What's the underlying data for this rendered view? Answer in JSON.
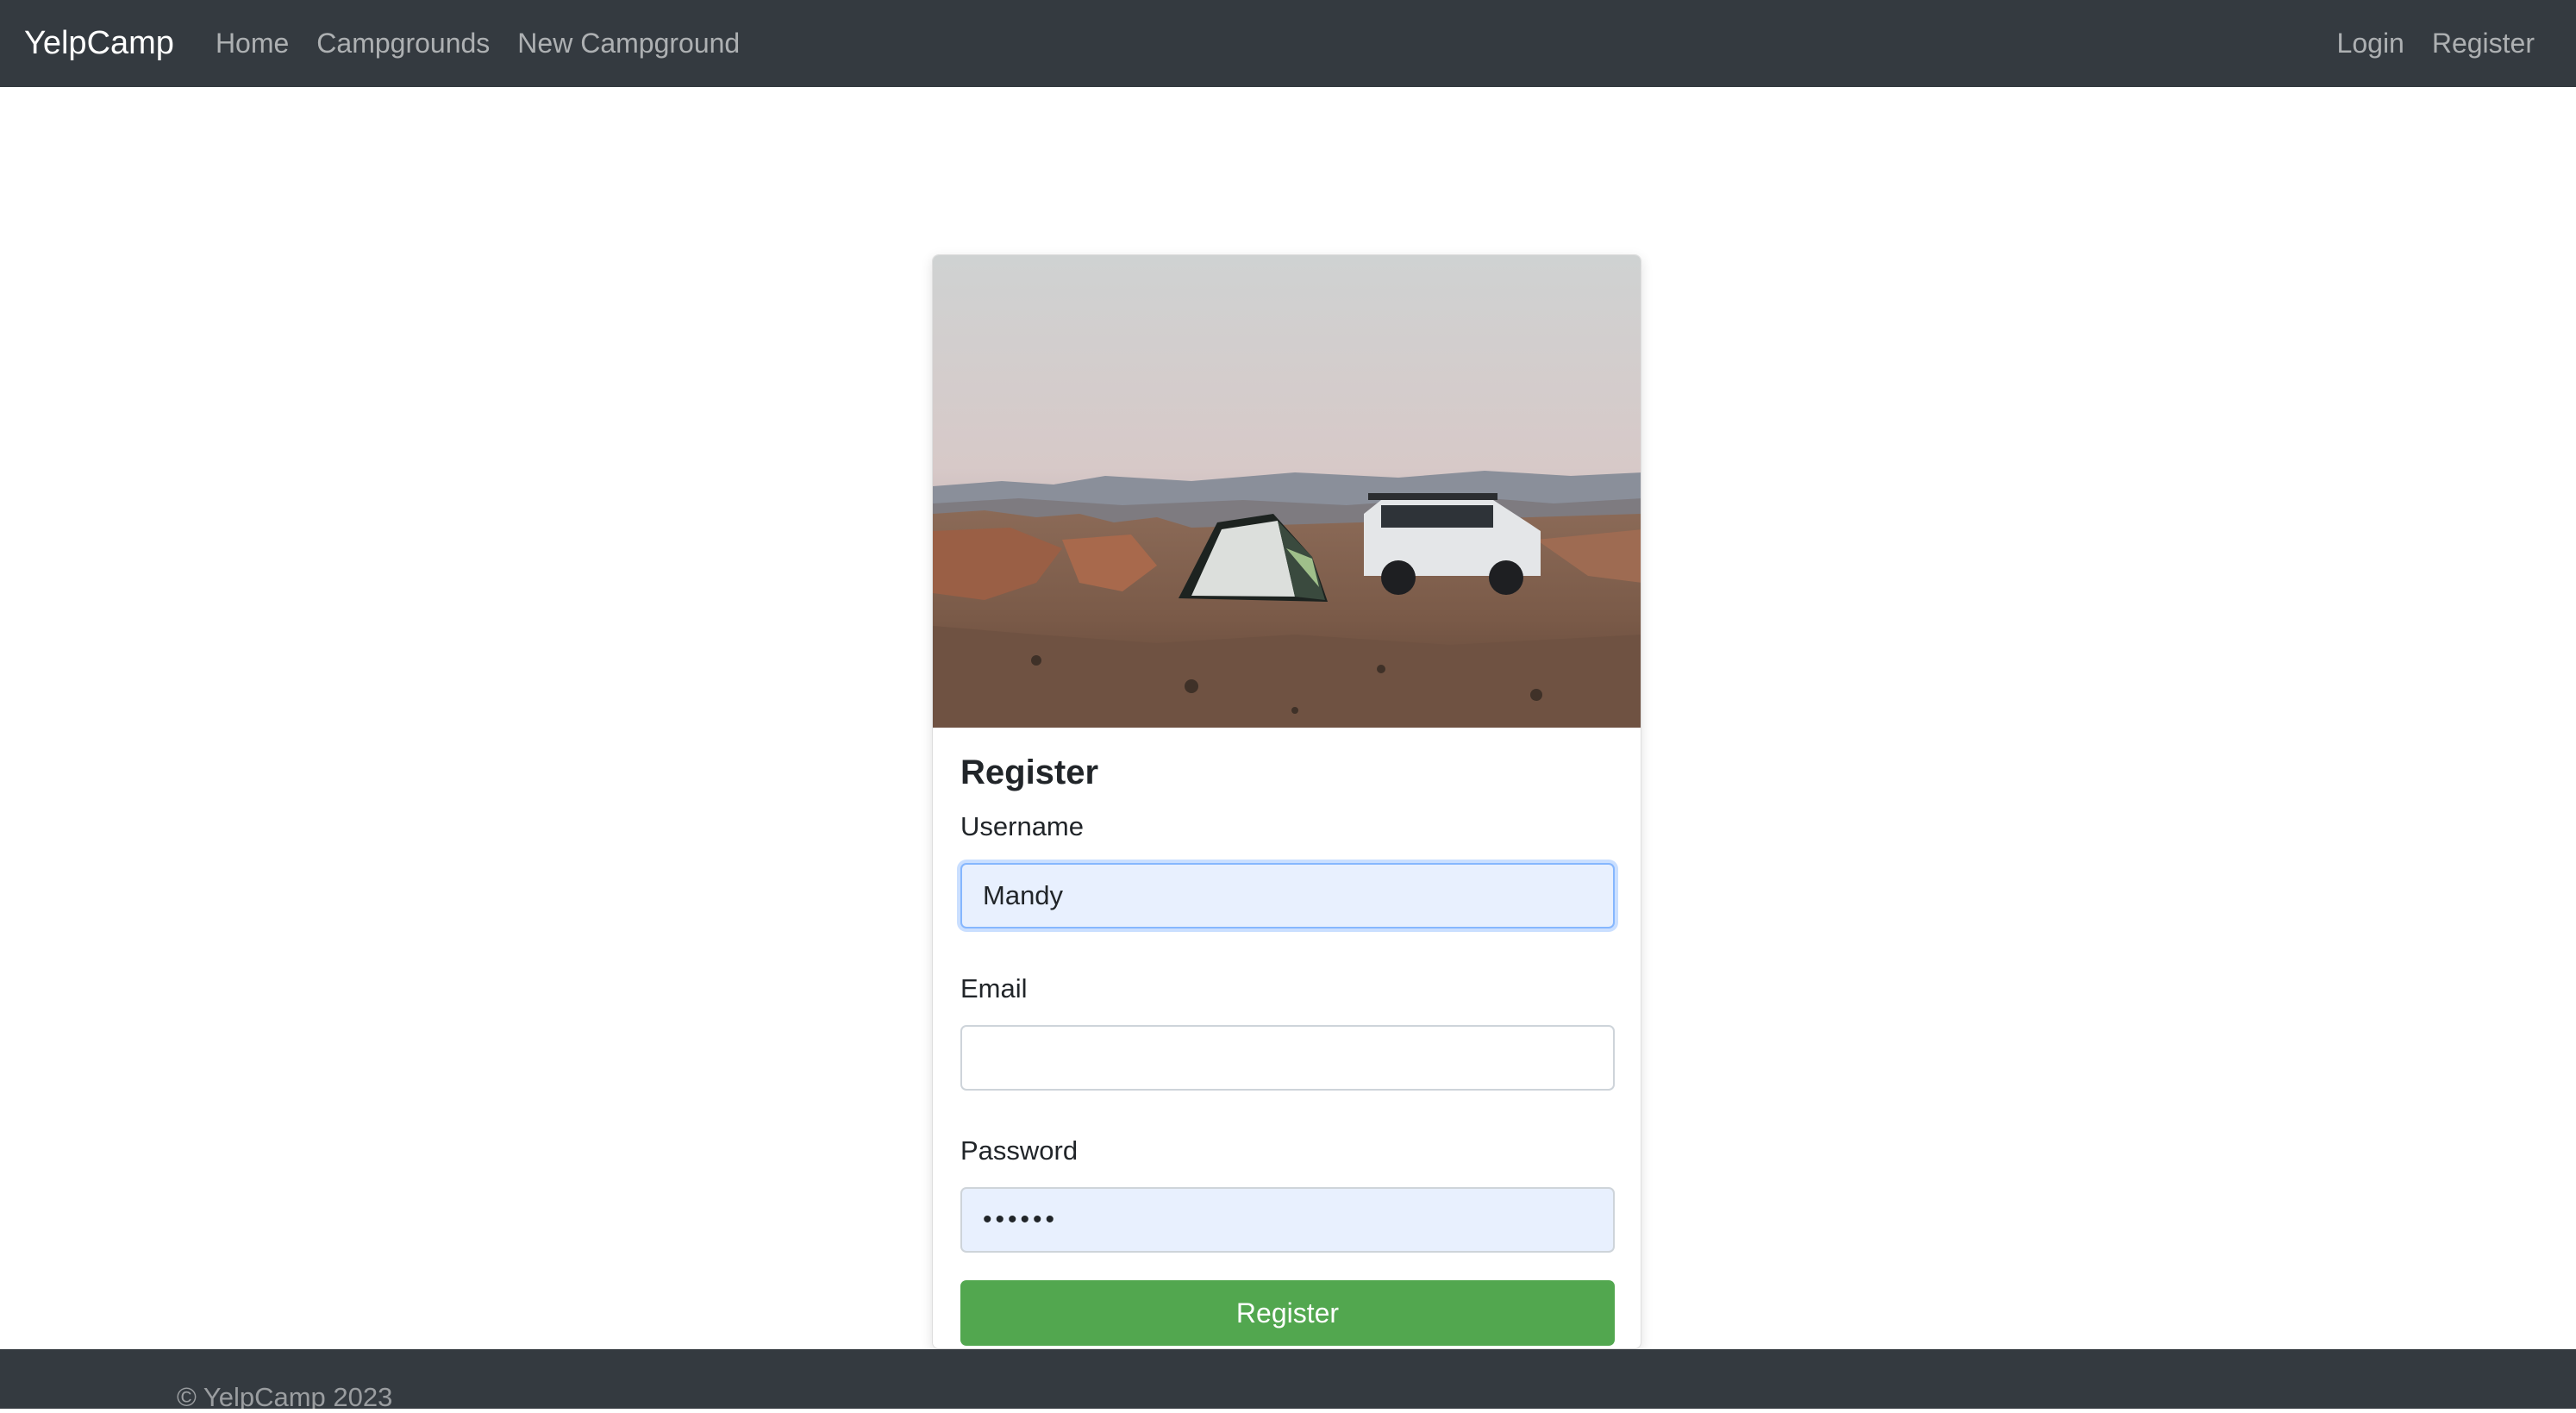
{
  "navbar": {
    "brand": "YelpCamp",
    "links": [
      "Home",
      "Campgrounds",
      "New Campground"
    ],
    "right_links": [
      "Login",
      "Register"
    ]
  },
  "card": {
    "title": "Register",
    "username": {
      "label": "Username",
      "value": "Mandy"
    },
    "email": {
      "label": "Email",
      "value": ""
    },
    "password": {
      "label": "Password",
      "value": "••••••"
    },
    "submit_label": "Register"
  },
  "footer": {
    "text": "© YelpCamp 2023"
  },
  "colors": {
    "navbar_bg": "#343a40",
    "button_green": "#52a74f",
    "autofill_bg": "#e8f0fe"
  }
}
